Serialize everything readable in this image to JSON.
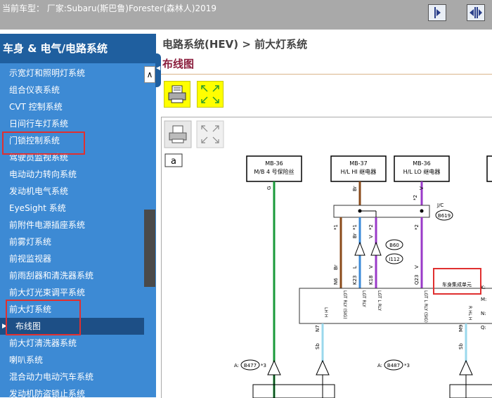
{
  "header": {
    "title": "当前车型： 厂家:Subaru(斯巴鲁)Forester(森林人)2019"
  },
  "sidebar": {
    "heading": "车身 & 电气/电路系统",
    "items": [
      {
        "label": "示宽灯和照明灯系统"
      },
      {
        "label": "组合仪表系统"
      },
      {
        "label": "CVT 控制系统"
      },
      {
        "label": "日间行车灯系统"
      },
      {
        "label": "门锁控制系统"
      },
      {
        "label": "驾驶员监视系统"
      },
      {
        "label": "电动动力转向系统"
      },
      {
        "label": "发动机电气系统"
      },
      {
        "label": "EyeSight 系统"
      },
      {
        "label": "前附件电源插座系统"
      },
      {
        "label": "前雾灯系统"
      },
      {
        "label": "前视监视器"
      },
      {
        "label": "前雨刮器和清洗器系统"
      },
      {
        "label": "前大灯光束调平系统"
      },
      {
        "label": "前大灯系统"
      },
      {
        "label": "布线图",
        "sub": true,
        "active": true
      },
      {
        "label": "前大灯清洗器系统"
      },
      {
        "label": "喇叭系统"
      },
      {
        "label": "混合动力电动汽车系统"
      },
      {
        "label": "发动机防盗锁止系统"
      }
    ]
  },
  "main": {
    "breadcrumb": "电路系统(HEV) > 前大灯系统",
    "subtitle": "布线图"
  },
  "diagram": {
    "tag": "a",
    "connectors": [
      {
        "id": "MB-36",
        "name": "M/B 4 号保险丝"
      },
      {
        "id": "MB-37",
        "name": "H/L HI 继电器"
      },
      {
        "id": "MB-36",
        "name": "H/L LO 继电器"
      }
    ],
    "wire_labels": {
      "w1": "G",
      "w2_top": "Br",
      "w3_top": "*2",
      "w3_v": "V",
      "jc": "J/C",
      "b619": "B619",
      "b60": "B60",
      "i112": "I112",
      "star1": "*1",
      "star1b": "*1",
      "br2": "Br",
      "star2": "*2",
      "v2": "V",
      "star2b": "*2",
      "br3": "Br",
      "l": "L",
      "v3": "V",
      "v4": "V",
      "n6": "N6",
      "k23": "K23",
      "k18": "K18",
      "q23": "Q23",
      "unit": "车身集成单元",
      "lgt_rly_sig": "LGT RLY (SIG)",
      "lgt_rly": "LGT RLY",
      "lgt_l_rly": "LGT L RLY",
      "lgt_l_rly_sig": "LGT L RLY (SIG)",
      "hl_hi": "LH H",
      "hl_h": "R HL H",
      "n7": "N7",
      "m9": "M9",
      "sb1": "Sb",
      "sb2": "Sb",
      "a1": "A:",
      "b477": "B477",
      "star3": "*3",
      "a2": "A:",
      "b487": "B487",
      "star3b": "*3",
      "k_pin": "K:",
      "m_pin": "M:",
      "n_pin": "N:",
      "q_pin": "Q:"
    }
  }
}
